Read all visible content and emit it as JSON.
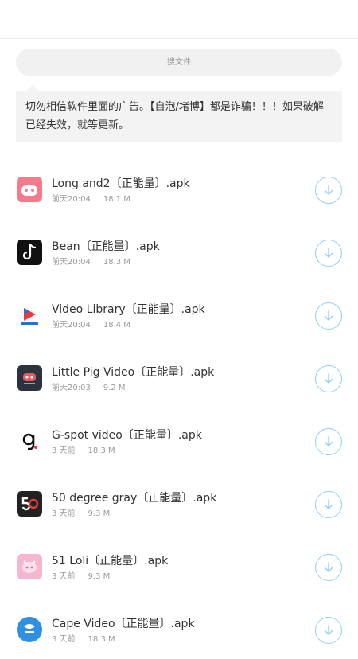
{
  "search": {
    "placeholder": "搜文件"
  },
  "notice": {
    "text": "切勿相信软件里面的广告。【自泡/堵博】都是诈骗！！！如果破解已经失效，就等更新。"
  },
  "files": [
    {
      "name": "Long and2〔正能量〕.apk",
      "time": "前天20:04",
      "size": "18.1 M",
      "icon": "long-and2-app-icon",
      "icon_bg": "#f47a8c"
    },
    {
      "name": "Bean〔正能量〕.apk",
      "time": "前天20:04",
      "size": "18.3 M",
      "icon": "bean-app-icon",
      "icon_bg": "#111111"
    },
    {
      "name": "Video Library〔正能量〕.apk",
      "time": "前天20:04",
      "size": "18.4 M",
      "icon": "video-library-app-icon",
      "icon_bg": "#ffffff"
    },
    {
      "name": "Little Pig Video〔正能量〕.apk",
      "time": "前天20:03",
      "size": "9.2 M",
      "icon": "little-pig-video-app-icon",
      "icon_bg": "#2b3340"
    },
    {
      "name": "G-spot video〔正能量〕.apk",
      "time": "3 天前",
      "size": "18.3 M",
      "icon": "g-spot-video-app-icon",
      "icon_bg": "#ffffff"
    },
    {
      "name": "50 degree gray〔正能量〕.apk",
      "time": "3 天前",
      "size": "9.3 M",
      "icon": "fifty-degree-gray-app-icon",
      "icon_bg": "#222222"
    },
    {
      "name": "51 Loli〔正能量〕.apk",
      "time": "3 天前",
      "size": "9.3 M",
      "icon": "fifty-one-loli-app-icon",
      "icon_bg": "#f6b6cf"
    },
    {
      "name": "Cape Video〔正能量〕.apk",
      "time": "3 天前",
      "size": "18.3 M",
      "icon": "cape-video-app-icon",
      "icon_bg": "#2f8fe0"
    }
  ],
  "colors": {
    "accent": "#8fd0f3",
    "muted": "#9a9a9a",
    "notice_bg": "#f3f3f3"
  }
}
